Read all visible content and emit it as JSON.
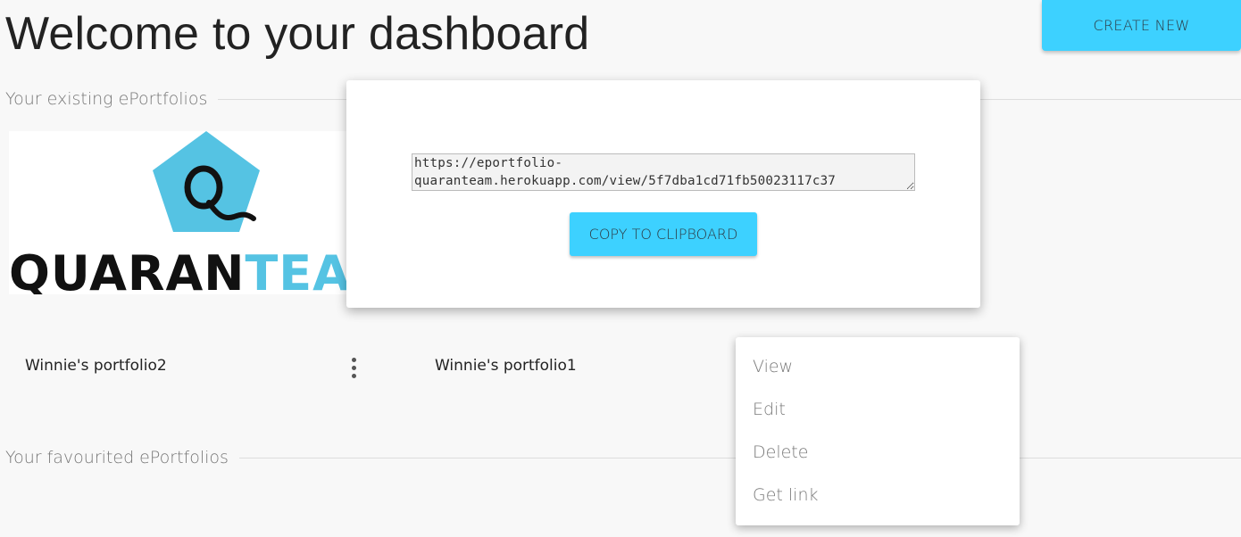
{
  "page_title": "Welcome to your dashboard",
  "create_button": "CREATE NEW",
  "sections": {
    "existing": "Your existing ePortfolios",
    "favourited": "Your favourited ePortfolios"
  },
  "portfolios": [
    {
      "title": "Winnie's portfolio2",
      "logo_text_dark": "QUARAN",
      "logo_text_light": "TEA"
    },
    {
      "title": "Winnie's portfolio1"
    }
  ],
  "share_modal": {
    "link": "https://eportfolio-quaranteam.herokuapp.com/view/5f7dba1cd71fb50023117c37",
    "copy_button": "COPY TO CLIPBOARD"
  },
  "context_menu": {
    "items": [
      "View",
      "Edit",
      "Delete",
      "Get link"
    ]
  },
  "colors": {
    "accent": "#3dd1ff",
    "logo_blue": "#55c3e3",
    "background": "#f8f8f8"
  },
  "icons": {
    "more": "vertical-ellipsis-icon"
  }
}
